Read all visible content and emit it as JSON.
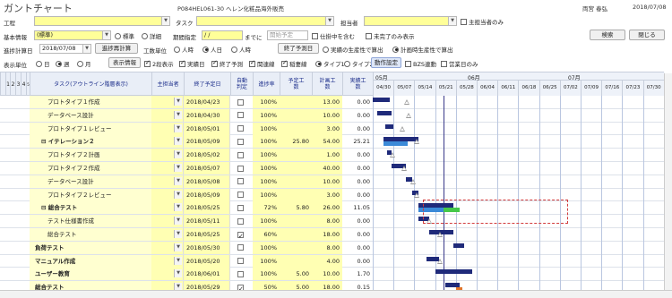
{
  "window": {
    "title": "ガントチャート",
    "project_id": "P084HEL061-30 ヘレン化粧品海外販売",
    "user": "両宮 春弘",
    "date": "2018/07/08"
  },
  "filters": {
    "koutei_label": "工程",
    "task_label": "タスク",
    "tantou_label": "担当者",
    "only_main_label": "主担当者のみ",
    "hyouji_label": "基本情報",
    "hyouji_value": "(標準)",
    "opt_hyoujun": "標準",
    "opt_shousai": "詳細",
    "kikan_label": "期間指定",
    "kikan_from": "/ /",
    "kikan_until": "までに",
    "kikan_to": "開始予定",
    "shinkou_label": "仕掛中を含む",
    "mikanryou_label": "未完了のみ表示",
    "search_button": "検索",
    "close_button": "閉じる"
  },
  "calc": {
    "keisan_label": "進捗計算日",
    "keisan_value": "2018/07/08",
    "recalc_button": "進捗再計算",
    "kousuu_label": "工数単位",
    "unit_person_hour": "人時",
    "unit_person_day": "人日",
    "unit_hour": "人時",
    "shuryou_label": "終了予測日",
    "opt_jisseki": "実績の生産性で算出",
    "opt_keikaku": "計画時生産性で算出"
  },
  "display": {
    "tani_label": "表示単位",
    "opt_day": "日",
    "opt_week": "週",
    "opt_month": "月",
    "info_label": "表示情報",
    "chk_2layer": "2段表示",
    "chk_jisseki": "実績日",
    "chk_shuryou": "終了予測",
    "chk_kanren": "関連線",
    "chk_inazuma": "稲妻線",
    "opt_type1": "タイプ1",
    "opt_type2": "タイプ2",
    "settings_button": "動作設定",
    "chk_sync": "BZS連動",
    "chk_eigyoubi": "営業日のみ"
  },
  "columns": {
    "levels": [
      "1",
      "2",
      "3",
      "4",
      "5"
    ],
    "task": "タスク(アウトライン階層表示)",
    "tantou": "主担当者",
    "shuryou": "終了予定日",
    "jidou": "自動判定",
    "shinchoku": "進捗率",
    "yotei": "予定工数",
    "keikaku": "計画工数",
    "jisseki": "実績工数"
  },
  "gantt": {
    "months": [
      "05月",
      "06月",
      "07月"
    ],
    "days": [
      "04/30",
      "05/07",
      "05/14",
      "05/21",
      "05/28",
      "06/04",
      "06/11",
      "06/18",
      "06/25",
      "07/02",
      "07/09",
      "07/16",
      "07/23",
      "07/30"
    ]
  },
  "rows": [
    {
      "name": "プロトタイプ１作成",
      "indent": 2,
      "date": "2018/04/23",
      "check": false,
      "progress": "100%",
      "yotei": "",
      "keikaku": "13.00",
      "jisseki": "0.00"
    },
    {
      "name": "データベース設計",
      "indent": 2,
      "date": "2018/04/30",
      "check": false,
      "progress": "100%",
      "yotei": "",
      "keikaku": "10.00",
      "jisseki": "0.00"
    },
    {
      "name": "プロトタイプ１レビュー",
      "indent": 2,
      "date": "2018/05/01",
      "check": false,
      "progress": "100%",
      "yotei": "",
      "keikaku": "3.00",
      "jisseki": "0.00"
    },
    {
      "name": "イテレーション２",
      "indent": 1,
      "date": "2018/05/09",
      "check": false,
      "progress": "100%",
      "yotei": "25.80",
      "keikaku": "54.00",
      "jisseki": "25.21",
      "group": true
    },
    {
      "name": "プロトタイプ２計画",
      "indent": 2,
      "date": "2018/05/02",
      "check": false,
      "progress": "100%",
      "yotei": "",
      "keikaku": "1.00",
      "jisseki": "0.00"
    },
    {
      "name": "プロトタイプ２作成",
      "indent": 2,
      "date": "2018/05/07",
      "check": false,
      "progress": "100%",
      "yotei": "",
      "keikaku": "40.00",
      "jisseki": "0.00"
    },
    {
      "name": "データベース設計",
      "indent": 2,
      "date": "2018/05/08",
      "check": false,
      "progress": "100%",
      "yotei": "",
      "keikaku": "10.00",
      "jisseki": "0.00"
    },
    {
      "name": "プロトタイプ２レビュー",
      "indent": 2,
      "date": "2018/05/09",
      "check": false,
      "progress": "100%",
      "yotei": "",
      "keikaku": "3.00",
      "jisseki": "0.00"
    },
    {
      "name": "総合テスト",
      "indent": 1,
      "date": "2018/05/25",
      "check": false,
      "progress": "72%",
      "yotei": "5.80",
      "keikaku": "26.00",
      "jisseki": "11.05",
      "group": true
    },
    {
      "name": "テスト仕様書作成",
      "indent": 2,
      "date": "2018/05/11",
      "check": false,
      "progress": "100%",
      "yotei": "",
      "keikaku": "8.00",
      "jisseki": "0.00"
    },
    {
      "name": "総合テスト",
      "indent": 2,
      "date": "2018/05/25",
      "check": true,
      "progress": "60%",
      "yotei": "",
      "keikaku": "18.00",
      "jisseki": "0.00"
    },
    {
      "name": "負荷テスト",
      "indent": 0,
      "date": "2018/05/30",
      "check": false,
      "progress": "100%",
      "yotei": "",
      "keikaku": "8.00",
      "jisseki": "0.00"
    },
    {
      "name": "マニュアル作成",
      "indent": 0,
      "date": "2018/05/20",
      "check": false,
      "progress": "100%",
      "yotei": "",
      "keikaku": "4.00",
      "jisseki": "0.00"
    },
    {
      "name": "ユーザー教育",
      "indent": 0,
      "date": "2018/06/01",
      "check": false,
      "progress": "100%",
      "yotei": "5.00",
      "keikaku": "10.00",
      "jisseki": "1.70"
    },
    {
      "name": "総合テスト",
      "indent": 0,
      "date": "2018/05/29",
      "check": true,
      "progress": "50%",
      "yotei": "5.00",
      "keikaku": "18.00",
      "jisseki": "0.15"
    }
  ],
  "colors": {
    "accent": "#1a2c8a",
    "input": "#ffff99",
    "bar_plan": "#1f2a7a",
    "bar_actual": "#3b8ad8",
    "bar_predict": "#46c84a",
    "highlight": "#d23c3c"
  }
}
